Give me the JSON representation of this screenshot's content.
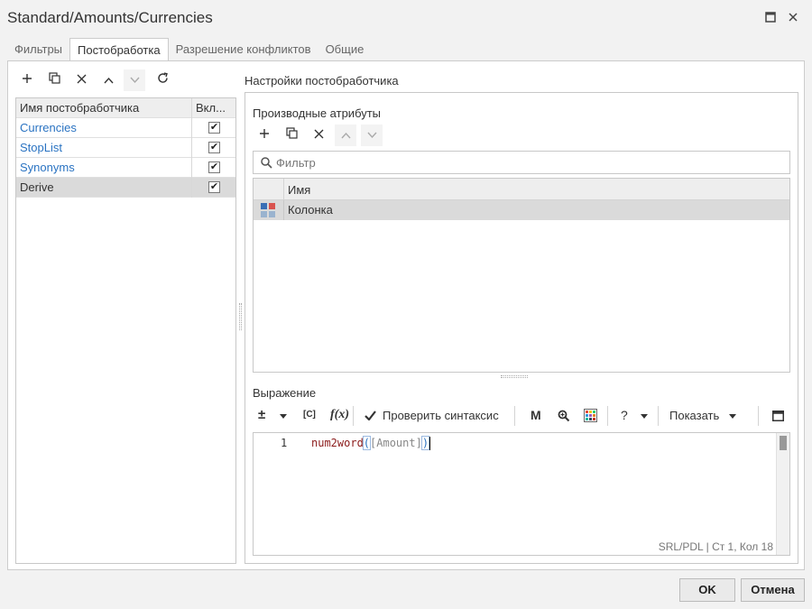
{
  "window": {
    "title": "Standard/Amounts/Currencies"
  },
  "tabs": [
    {
      "label": "Фильтры"
    },
    {
      "label": "Постобработка"
    },
    {
      "label": "Разрешение конфликтов"
    },
    {
      "label": "Общие"
    }
  ],
  "processors": {
    "col_name": "Имя постобработчика",
    "col_enabled": "Вкл...",
    "rows": [
      {
        "name": "Currencies",
        "enabled": "✔"
      },
      {
        "name": "StopList",
        "enabled": "✔"
      },
      {
        "name": "Synonyms",
        "enabled": "✔"
      },
      {
        "name": "Derive",
        "enabled": "✔"
      }
    ]
  },
  "settings": {
    "title": "Настройки постобработчика",
    "derived_title": "Производные атрибуты",
    "filter_placeholder": "Фильтр",
    "col_name": "Имя",
    "rows": [
      {
        "name": "Колонка"
      }
    ],
    "expression_title": "Выражение",
    "check_syntax": "Проверить синтаксис",
    "show_label": "Показать",
    "m_label": "M",
    "c_label": "[C]",
    "fx_label": "f(x)",
    "help_label": "?",
    "plusminus_label": "±"
  },
  "code": {
    "line_no": "1",
    "fn": "num2word",
    "open": "(",
    "arg": "[Amount]",
    "close": ")",
    "status": "SRL/PDL | Ст 1, Кол 18"
  },
  "footer": {
    "ok": "OK",
    "cancel": "Отмена"
  },
  "colors": {
    "accent": "#2a73c2",
    "selected": "#dadada"
  },
  "icons": [
    "add-icon",
    "copy-icon",
    "delete-icon",
    "up-icon",
    "down-icon",
    "refresh-icon",
    "search-icon",
    "check-icon",
    "zoom-icon",
    "palette-icon",
    "maximize-icon",
    "close-icon"
  ]
}
